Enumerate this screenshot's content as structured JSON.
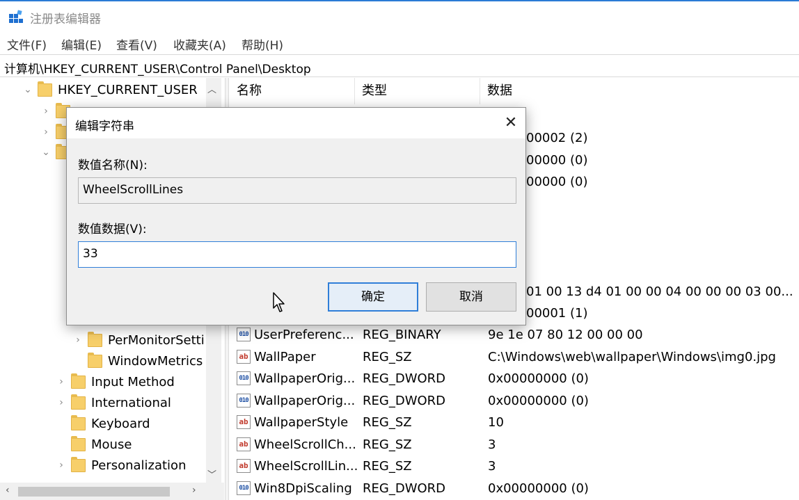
{
  "window": {
    "title": "注册表编辑器"
  },
  "menu": [
    "文件(F)",
    "编辑(E)",
    "查看(V)",
    "收藏夹(A)",
    "帮助(H)"
  ],
  "address": "计算机\\HKEY_CURRENT_USER\\Control Panel\\Desktop",
  "tree": {
    "root": "HKEY_CURRENT_USER",
    "items": [
      "PerMonitorSetti",
      "WindowMetrics",
      "Input Method",
      "International",
      "Keyboard",
      "Mouse",
      "Personalization"
    ]
  },
  "list": {
    "headers": {
      "name": "名称",
      "type": "类型",
      "data": "数据"
    },
    "partial_rows": [
      "00002 (2)",
      "00000 (0)",
      "00000 (0)",
      "01 00 13 d4 01 00 00 04 00 00 00 03 00...",
      "00001 (1)"
    ],
    "rows": [
      {
        "icon": "binary",
        "name": "UserPreferenc...",
        "type": "REG_BINARY",
        "data": "9e 1e 07 80 12 00 00 00"
      },
      {
        "icon": "string",
        "name": "WallPaper",
        "type": "REG_SZ",
        "data": "C:\\Windows\\web\\wallpaper\\Windows\\img0.jpg"
      },
      {
        "icon": "binary",
        "name": "WallpaperOrig...",
        "type": "REG_DWORD",
        "data": "0x00000000 (0)"
      },
      {
        "icon": "binary",
        "name": "WallpaperOrig...",
        "type": "REG_DWORD",
        "data": "0x00000000 (0)"
      },
      {
        "icon": "string",
        "name": "WallpaperStyle",
        "type": "REG_SZ",
        "data": "10"
      },
      {
        "icon": "string",
        "name": "WheelScrollCh...",
        "type": "REG_SZ",
        "data": "3"
      },
      {
        "icon": "string",
        "name": "WheelScrollLin...",
        "type": "REG_SZ",
        "data": "3"
      },
      {
        "icon": "binary",
        "name": "Win8DpiScaling",
        "type": "REG_DWORD",
        "data": "0x00000000 (0)"
      }
    ]
  },
  "dialog": {
    "title": "编辑字符串",
    "close": "✕",
    "name_label": "数值名称(N):",
    "name_value": "WheelScrollLines",
    "data_label": "数值数据(V):",
    "data_value": "33",
    "ok": "确定",
    "cancel": "取消"
  },
  "icons": {
    "string": "ab",
    "binary": "010"
  },
  "colors": {
    "accent": "#2f7ed8",
    "folder": "#f7cf6a"
  }
}
